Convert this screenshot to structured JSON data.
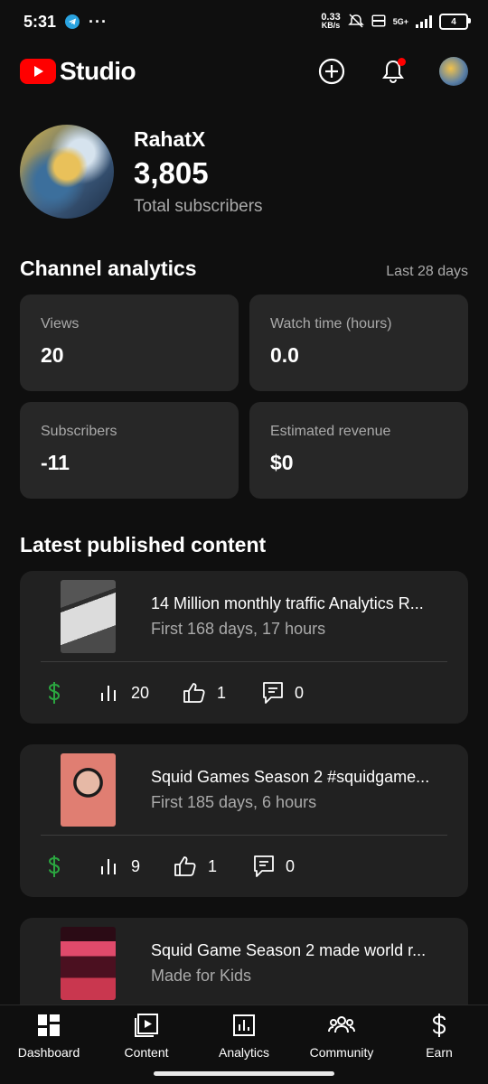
{
  "status_bar": {
    "time": "5:31",
    "dots": "···",
    "net_rate_value": "0.33",
    "net_rate_unit": "KB/s",
    "network_type": "5G+",
    "battery": "4"
  },
  "header": {
    "logo_text": "Studio",
    "accent_color": "#ff0000"
  },
  "channel": {
    "name": "RahatX",
    "subscriber_count": "3,805",
    "subscriber_label": "Total subscribers"
  },
  "analytics": {
    "title": "Channel analytics",
    "period": "Last 28 days",
    "stats": [
      {
        "label": "Views",
        "value": "20"
      },
      {
        "label": "Watch time (hours)",
        "value": "0.0"
      },
      {
        "label": "Subscribers",
        "value": "-11"
      },
      {
        "label": "Estimated revenue",
        "value": "$0"
      }
    ]
  },
  "latest": {
    "title": "Latest published content",
    "items": [
      {
        "title": "14 Million monthly traffic Analytics R...",
        "subtitle": "First 168 days, 17 hours",
        "views": "20",
        "likes": "1",
        "comments": "0"
      },
      {
        "title": "Squid Games Season 2 #squidgame...",
        "subtitle": "First 185 days, 6 hours",
        "views": "9",
        "likes": "1",
        "comments": "0"
      },
      {
        "title": "Squid Game Season 2 made world r...",
        "subtitle": "Made for Kids"
      }
    ]
  },
  "bottom_nav": [
    {
      "label": "Dashboard",
      "icon": "dashboard-icon"
    },
    {
      "label": "Content",
      "icon": "content-icon"
    },
    {
      "label": "Analytics",
      "icon": "analytics-icon"
    },
    {
      "label": "Community",
      "icon": "community-icon"
    },
    {
      "label": "Earn",
      "icon": "dollar-icon"
    }
  ],
  "colors": {
    "background": "#0f0f0f",
    "card": "#272727",
    "revenue_green": "#2ba640"
  }
}
